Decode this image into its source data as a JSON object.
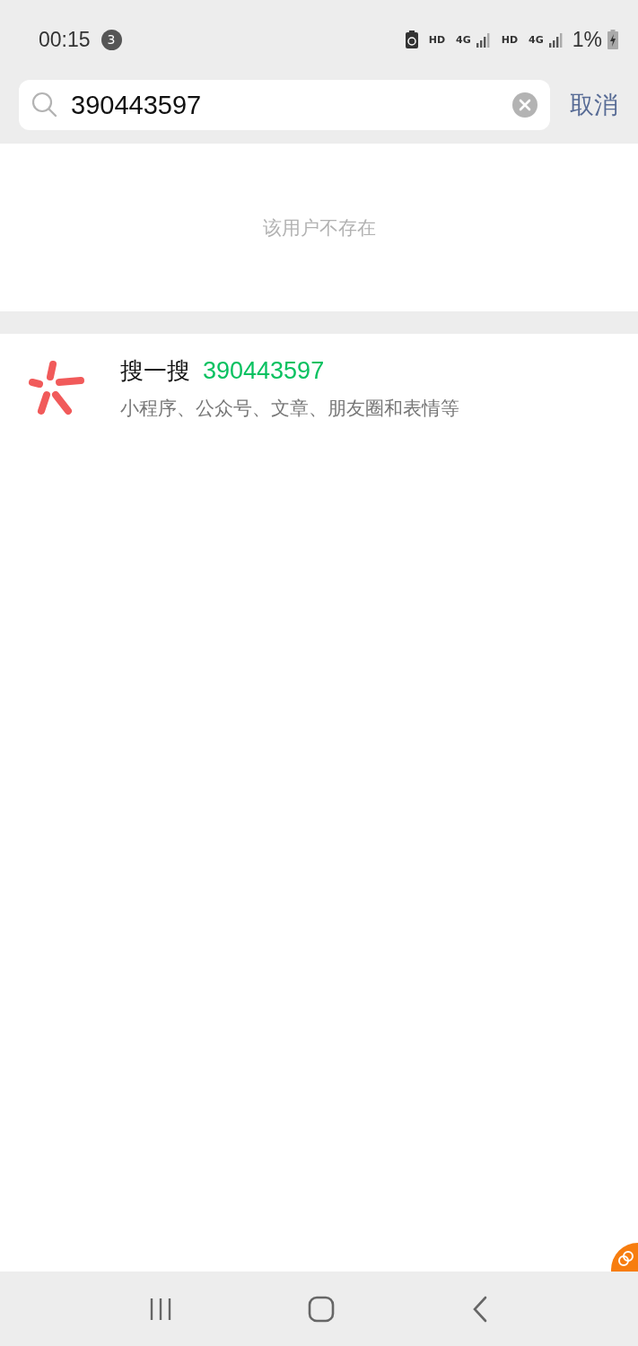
{
  "status_bar": {
    "time": "00:15",
    "notification_count": "3",
    "network_labels": [
      "HD",
      "4G",
      "HD",
      "4G"
    ],
    "battery": "1%"
  },
  "search": {
    "value": "390443597",
    "cancel": "取消"
  },
  "empty_message": "该用户不存在",
  "search_result": {
    "title": "搜一搜",
    "query": "390443597",
    "subtitle": "小程序、公众号、文章、朋友圈和表情等"
  }
}
